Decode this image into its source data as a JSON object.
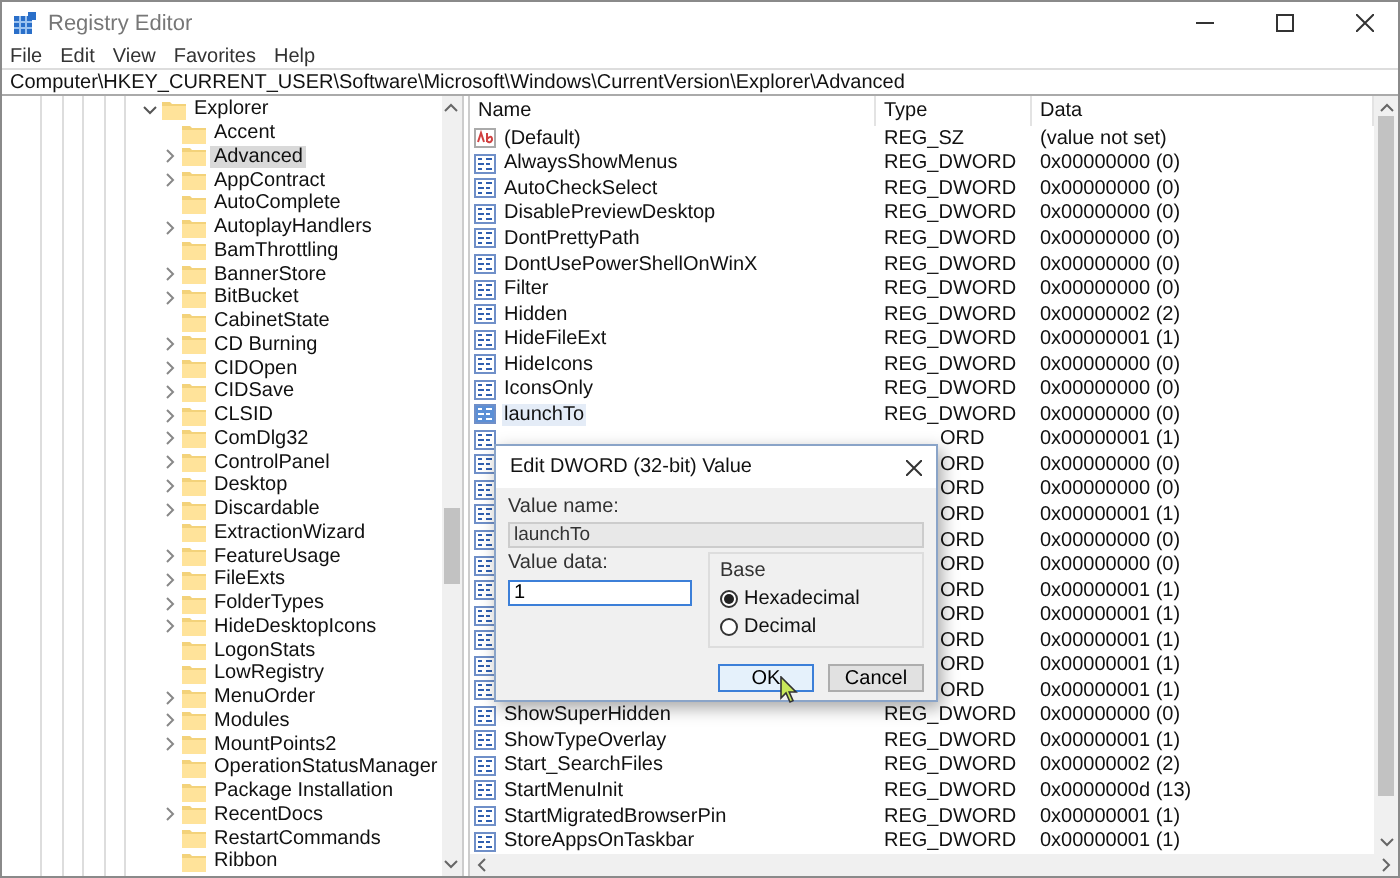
{
  "window": {
    "title": "Registry Editor"
  },
  "menu": [
    "File",
    "Edit",
    "View",
    "Favorites",
    "Help"
  ],
  "address": "Computer\\HKEY_CURRENT_USER\\Software\\Microsoft\\Windows\\CurrentVersion\\Explorer\\Advanced",
  "tree": [
    {
      "label": "Explorer",
      "expanded": true,
      "selected": false,
      "children": [
        {
          "label": "Accent",
          "has_children": false,
          "selected": false
        },
        {
          "label": "Advanced",
          "has_children": true,
          "selected": true
        },
        {
          "label": "AppContract",
          "has_children": true,
          "selected": false
        },
        {
          "label": "AutoComplete",
          "has_children": false,
          "selected": false
        },
        {
          "label": "AutoplayHandlers",
          "has_children": true,
          "selected": false
        },
        {
          "label": "BamThrottling",
          "has_children": false,
          "selected": false
        },
        {
          "label": "BannerStore",
          "has_children": true,
          "selected": false
        },
        {
          "label": "BitBucket",
          "has_children": true,
          "selected": false
        },
        {
          "label": "CabinetState",
          "has_children": false,
          "selected": false
        },
        {
          "label": "CD Burning",
          "has_children": true,
          "selected": false
        },
        {
          "label": "CIDOpen",
          "has_children": true,
          "selected": false
        },
        {
          "label": "CIDSave",
          "has_children": true,
          "selected": false
        },
        {
          "label": "CLSID",
          "has_children": true,
          "selected": false
        },
        {
          "label": "ComDlg32",
          "has_children": true,
          "selected": false
        },
        {
          "label": "ControlPanel",
          "has_children": true,
          "selected": false
        },
        {
          "label": "Desktop",
          "has_children": true,
          "selected": false
        },
        {
          "label": "Discardable",
          "has_children": true,
          "selected": false
        },
        {
          "label": "ExtractionWizard",
          "has_children": false,
          "selected": false
        },
        {
          "label": "FeatureUsage",
          "has_children": true,
          "selected": false
        },
        {
          "label": "FileExts",
          "has_children": true,
          "selected": false
        },
        {
          "label": "FolderTypes",
          "has_children": true,
          "selected": false
        },
        {
          "label": "HideDesktopIcons",
          "has_children": true,
          "selected": false
        },
        {
          "label": "LogonStats",
          "has_children": false,
          "selected": false
        },
        {
          "label": "LowRegistry",
          "has_children": false,
          "selected": false
        },
        {
          "label": "MenuOrder",
          "has_children": true,
          "selected": false
        },
        {
          "label": "Modules",
          "has_children": true,
          "selected": false
        },
        {
          "label": "MountPoints2",
          "has_children": true,
          "selected": false
        },
        {
          "label": "OperationStatusManager",
          "has_children": false,
          "selected": false
        },
        {
          "label": "Package Installation",
          "has_children": false,
          "selected": false
        },
        {
          "label": "RecentDocs",
          "has_children": true,
          "selected": false
        },
        {
          "label": "RestartCommands",
          "has_children": false,
          "selected": false
        },
        {
          "label": "Ribbon",
          "has_children": false,
          "selected": false
        }
      ]
    }
  ],
  "columns": [
    "Name",
    "Type",
    "Data"
  ],
  "values": [
    {
      "kind": "string",
      "name": "(Default)",
      "type": "REG_SZ",
      "data": "(value not set)",
      "selected": false
    },
    {
      "kind": "dword",
      "name": "AlwaysShowMenus",
      "type": "REG_DWORD",
      "data": "0x00000000 (0)",
      "selected": false
    },
    {
      "kind": "dword",
      "name": "AutoCheckSelect",
      "type": "REG_DWORD",
      "data": "0x00000000 (0)",
      "selected": false
    },
    {
      "kind": "dword",
      "name": "DisablePreviewDesktop",
      "type": "REG_DWORD",
      "data": "0x00000000 (0)",
      "selected": false
    },
    {
      "kind": "dword",
      "name": "DontPrettyPath",
      "type": "REG_DWORD",
      "data": "0x00000000 (0)",
      "selected": false
    },
    {
      "kind": "dword",
      "name": "DontUsePowerShellOnWinX",
      "type": "REG_DWORD",
      "data": "0x00000000 (0)",
      "selected": false
    },
    {
      "kind": "dword",
      "name": "Filter",
      "type": "REG_DWORD",
      "data": "0x00000000 (0)",
      "selected": false
    },
    {
      "kind": "dword",
      "name": "Hidden",
      "type": "REG_DWORD",
      "data": "0x00000002 (2)",
      "selected": false
    },
    {
      "kind": "dword",
      "name": "HideFileExt",
      "type": "REG_DWORD",
      "data": "0x00000001 (1)",
      "selected": false
    },
    {
      "kind": "dword",
      "name": "HideIcons",
      "type": "REG_DWORD",
      "data": "0x00000000 (0)",
      "selected": false
    },
    {
      "kind": "dword",
      "name": "IconsOnly",
      "type": "REG_DWORD",
      "data": "0x00000000 (0)",
      "selected": false
    },
    {
      "kind": "dword",
      "name": "launchTo",
      "type": "REG_DWORD",
      "data": "0x00000000 (0)",
      "selected": true
    },
    {
      "kind": "covered",
      "type": "ORD",
      "data": "0x00000001 (1)",
      "selected": false
    },
    {
      "kind": "covered",
      "type": "ORD",
      "data": "0x00000000 (0)",
      "selected": false
    },
    {
      "kind": "covered",
      "type": "ORD",
      "data": "0x00000000 (0)",
      "selected": false
    },
    {
      "kind": "covered",
      "type": "ORD",
      "data": "0x00000001 (1)",
      "selected": false
    },
    {
      "kind": "covered",
      "type": "ORD",
      "data": "0x00000000 (0)",
      "selected": false
    },
    {
      "kind": "covered",
      "type": "ORD",
      "data": "0x00000000 (0)",
      "selected": false
    },
    {
      "kind": "covered",
      "type": "ORD",
      "data": "0x00000001 (1)",
      "selected": false
    },
    {
      "kind": "covered",
      "type": "ORD",
      "data": "0x00000001 (1)",
      "selected": false
    },
    {
      "kind": "covered",
      "type": "ORD",
      "data": "0x00000001 (1)",
      "selected": false
    },
    {
      "kind": "covered",
      "type": "ORD",
      "data": "0x00000001 (1)",
      "selected": false
    },
    {
      "kind": "covered",
      "type": "ORD",
      "data": "0x00000001 (1)",
      "selected": false
    },
    {
      "kind": "dword",
      "name": "ShowSuperHidden",
      "type": "REG_DWORD",
      "data": "0x00000000 (0)",
      "selected": false
    },
    {
      "kind": "dword",
      "name": "ShowTypeOverlay",
      "type": "REG_DWORD",
      "data": "0x00000001 (1)",
      "selected": false
    },
    {
      "kind": "dword",
      "name": "Start_SearchFiles",
      "type": "REG_DWORD",
      "data": "0x00000002 (2)",
      "selected": false
    },
    {
      "kind": "dword",
      "name": "StartMenuInit",
      "type": "REG_DWORD",
      "data": "0x0000000d (13)",
      "selected": false
    },
    {
      "kind": "dword",
      "name": "StartMigratedBrowserPin",
      "type": "REG_DWORD",
      "data": "0x00000001 (1)",
      "selected": false
    },
    {
      "kind": "dword",
      "name": "StoreAppsOnTaskbar",
      "type": "REG_DWORD",
      "data": "0x00000001 (1)",
      "selected": false
    }
  ],
  "dialog": {
    "title": "Edit DWORD (32-bit) Value",
    "name_label": "Value name:",
    "name_value": "launchTo",
    "data_label": "Value data:",
    "data_value": "1",
    "base_label": "Base",
    "bases": [
      {
        "label": "Hexadecimal",
        "selected": true
      },
      {
        "label": "Decimal",
        "selected": false
      }
    ],
    "buttons": [
      {
        "label": "OK",
        "focused": true
      },
      {
        "label": "Cancel",
        "focused": false
      }
    ]
  }
}
